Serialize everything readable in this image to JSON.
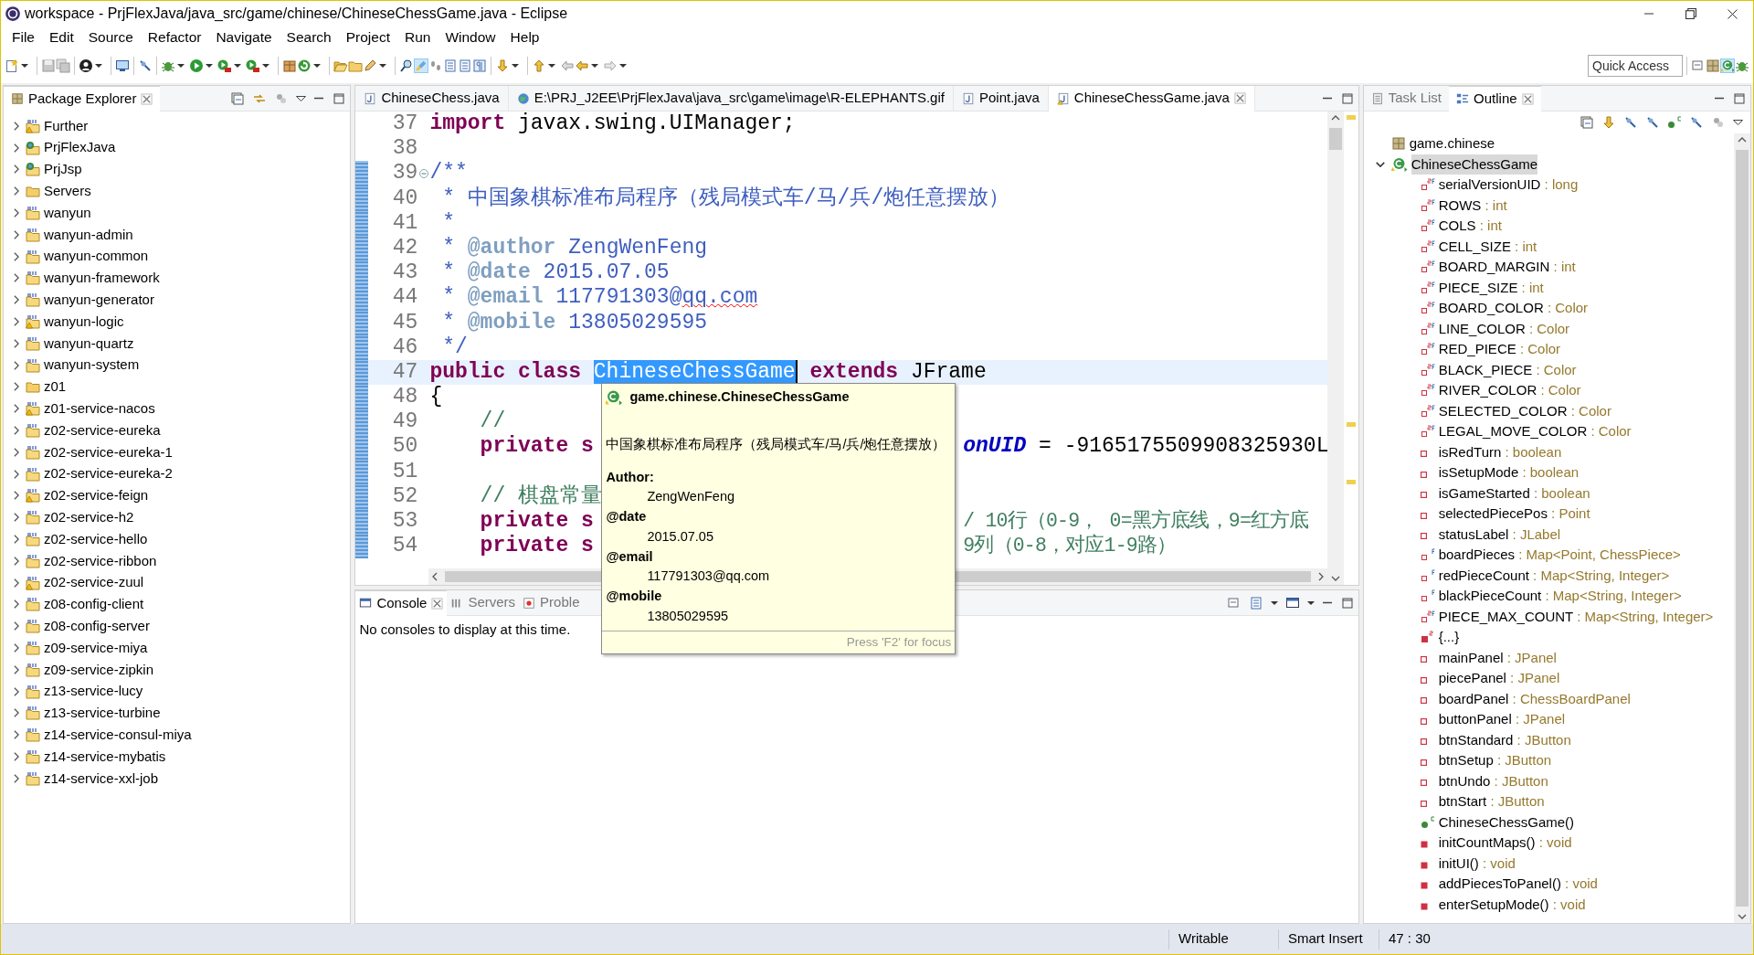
{
  "window": {
    "title": "workspace - PrjFlexJava/java_src/game/chinese/ChineseChessGame.java - Eclipse"
  },
  "menu": [
    "File",
    "Edit",
    "Source",
    "Refactor",
    "Navigate",
    "Search",
    "Project",
    "Run",
    "Window",
    "Help"
  ],
  "quick_access": {
    "placeholder": "Quick Access"
  },
  "package_explorer": {
    "title": "Package Explorer",
    "items": [
      {
        "label": "Further",
        "kind": "maven-warning",
        "expanded": false,
        "selected": false
      },
      {
        "label": "PrjFlexJava",
        "kind": "web",
        "expanded": false,
        "selected": false
      },
      {
        "label": "PrjJsp",
        "kind": "web",
        "expanded": false,
        "selected": false
      },
      {
        "label": "Servers",
        "kind": "folder",
        "expanded": false,
        "selected": false
      },
      {
        "label": "wanyun",
        "kind": "maven",
        "expanded": false,
        "selected": false
      },
      {
        "label": "wanyun-admin",
        "kind": "maven",
        "expanded": false,
        "selected": false
      },
      {
        "label": "wanyun-common",
        "kind": "maven",
        "expanded": false,
        "selected": false
      },
      {
        "label": "wanyun-framework",
        "kind": "maven",
        "expanded": false,
        "selected": false
      },
      {
        "label": "wanyun-generator",
        "kind": "maven",
        "expanded": false,
        "selected": false
      },
      {
        "label": "wanyun-logic",
        "kind": "maven-warning",
        "expanded": false,
        "selected": false
      },
      {
        "label": "wanyun-quartz",
        "kind": "maven",
        "expanded": false,
        "selected": false
      },
      {
        "label": "wanyun-system",
        "kind": "maven",
        "expanded": false,
        "selected": false
      },
      {
        "label": "z01",
        "kind": "folder",
        "expanded": false,
        "selected": false
      },
      {
        "label": "z01-service-nacos",
        "kind": "maven-warning",
        "expanded": false,
        "selected": false
      },
      {
        "label": "z02-service-eureka",
        "kind": "maven",
        "expanded": false,
        "selected": false
      },
      {
        "label": "z02-service-eureka-1",
        "kind": "maven",
        "expanded": false,
        "selected": false
      },
      {
        "label": "z02-service-eureka-2",
        "kind": "maven",
        "expanded": false,
        "selected": false
      },
      {
        "label": "z02-service-feign",
        "kind": "maven-warning",
        "expanded": false,
        "selected": false
      },
      {
        "label": "z02-service-h2",
        "kind": "maven",
        "expanded": false,
        "selected": false
      },
      {
        "label": "z02-service-hello",
        "kind": "maven",
        "expanded": false,
        "selected": false
      },
      {
        "label": "z02-service-ribbon",
        "kind": "maven",
        "expanded": false,
        "selected": false
      },
      {
        "label": "z02-service-zuul",
        "kind": "maven-warning",
        "expanded": false,
        "selected": false
      },
      {
        "label": "z08-config-client",
        "kind": "maven",
        "expanded": false,
        "selected": false
      },
      {
        "label": "z08-config-server",
        "kind": "maven",
        "expanded": false,
        "selected": false
      },
      {
        "label": "z09-service-miya",
        "kind": "maven",
        "expanded": false,
        "selected": false
      },
      {
        "label": "z09-service-zipkin",
        "kind": "maven",
        "expanded": false,
        "selected": false
      },
      {
        "label": "z13-service-lucy",
        "kind": "maven",
        "expanded": false,
        "selected": false
      },
      {
        "label": "z13-service-turbine",
        "kind": "maven",
        "expanded": false,
        "selected": false
      },
      {
        "label": "z14-service-consul-miya",
        "kind": "maven",
        "expanded": false,
        "selected": false
      },
      {
        "label": "z14-service-mybatis",
        "kind": "maven",
        "expanded": false,
        "selected": false
      },
      {
        "label": "z14-service-xxl-job",
        "kind": "maven",
        "expanded": false,
        "selected": false
      }
    ]
  },
  "editor": {
    "tabs": [
      {
        "label": "ChineseChess.java",
        "kind": "java",
        "selected": false
      },
      {
        "label": "E:\\PRJ_J2EE\\PrjFlexJava\\java_src\\game\\image\\R-ELEPHANTS.gif",
        "kind": "image",
        "selected": false
      },
      {
        "label": "Point.java",
        "kind": "java",
        "selected": false
      },
      {
        "label": "ChineseChessGame.java",
        "kind": "java-warning",
        "selected": true
      }
    ],
    "lines": [
      {
        "number": "37",
        "current": false,
        "changed": false,
        "foldable": false,
        "tokens": [
          {
            "text": "import",
            "kind": "keyword"
          },
          {
            "text": " javax.swing.UIManager;",
            "kind": "plain"
          }
        ]
      },
      {
        "number": "38",
        "current": false,
        "changed": false,
        "foldable": false
      },
      {
        "number": "39",
        "current": false,
        "changed": true,
        "foldable": true,
        "tokens": [
          {
            "text": "/**",
            "kind": "javadoc"
          }
        ]
      },
      {
        "number": "40",
        "current": false,
        "changed": true,
        "foldable": false,
        "tokens": [
          {
            "text": " * 中国象棋标准布局程序（残局模式车/马/兵/炮任意摆放）",
            "kind": "javadoc"
          }
        ]
      },
      {
        "number": "41",
        "current": false,
        "changed": true,
        "foldable": false,
        "tokens": [
          {
            "text": " *",
            "kind": "javadoc"
          }
        ]
      },
      {
        "number": "42",
        "current": false,
        "changed": true,
        "foldable": false,
        "tokens": [
          {
            "text": " * ",
            "kind": "javadoc"
          },
          {
            "text": "@author",
            "kind": "javadoc-tag"
          },
          {
            "text": " ZengWenFeng",
            "kind": "javadoc"
          }
        ]
      },
      {
        "number": "43",
        "current": false,
        "changed": true,
        "foldable": false,
        "tokens": [
          {
            "text": " * ",
            "kind": "javadoc"
          },
          {
            "text": "@date",
            "kind": "javadoc-tag"
          },
          {
            "text": " 2015.07.05",
            "kind": "javadoc"
          }
        ]
      },
      {
        "number": "44",
        "current": false,
        "changed": true,
        "foldable": false,
        "tokens": [
          {
            "text": " * ",
            "kind": "javadoc"
          },
          {
            "text": "@email",
            "kind": "javadoc-tag"
          },
          {
            "text": " 117791303@",
            "kind": "javadoc"
          },
          {
            "text": "qq.com",
            "kind": "misspelled"
          }
        ]
      },
      {
        "number": "45",
        "current": false,
        "changed": true,
        "foldable": false,
        "tokens": [
          {
            "text": " * ",
            "kind": "javadoc"
          },
          {
            "text": "@mobile",
            "kind": "javadoc-tag"
          },
          {
            "text": " 13805029595",
            "kind": "javadoc"
          }
        ]
      },
      {
        "number": "46",
        "current": false,
        "changed": true,
        "foldable": false,
        "tokens": [
          {
            "text": " */",
            "kind": "javadoc"
          }
        ]
      },
      {
        "number": "47",
        "current": true,
        "changed": true,
        "foldable": false,
        "tokens": [
          {
            "text": "public class ",
            "kind": "keyword"
          },
          {
            "text": "ChineseChessGame",
            "kind": "selection"
          },
          {
            "text": " extends",
            "kind": "keyword"
          },
          {
            "text": " JFrame",
            "kind": "plain"
          }
        ]
      },
      {
        "number": "48",
        "current": false,
        "changed": true,
        "foldable": false,
        "tokens": [
          {
            "text": "{",
            "kind": "plain"
          }
        ]
      },
      {
        "number": "49",
        "current": false,
        "changed": true,
        "foldable": false,
        "tokens": [
          {
            "text": "    //",
            "kind": "comment"
          }
        ]
      },
      {
        "number": "50",
        "current": false,
        "changed": true,
        "foldable": false,
        "tokens": [
          {
            "text": "    private s",
            "kind": "keyword"
          }
        ],
        "right": [
          {
            "text": "onUID",
            "kind": "static-field"
          },
          {
            "text": " = -9165175509908325930L",
            "kind": "plain"
          }
        ]
      },
      {
        "number": "51",
        "current": false,
        "changed": true,
        "foldable": false
      },
      {
        "number": "52",
        "current": false,
        "changed": true,
        "foldable": false,
        "tokens": [
          {
            "text": "    // 棋盘常量",
            "kind": "comment"
          }
        ]
      },
      {
        "number": "53",
        "current": false,
        "changed": true,
        "foldable": false,
        "tokens": [
          {
            "text": "    private s",
            "kind": "keyword"
          }
        ],
        "right": [
          {
            "text": "/ 10行（0-9， 0=黑方底线，9=红方底",
            "kind": "comment"
          }
        ]
      },
      {
        "number": "54",
        "current": false,
        "changed": true,
        "foldable": false,
        "tokens": [
          {
            "text": "    private s",
            "kind": "keyword"
          }
        ],
        "right": [
          {
            "text": "9列（0-8，对应1-9路）",
            "kind": "comment"
          }
        ]
      }
    ]
  },
  "tooltip": {
    "title": "game.chinese.ChineseChessGame",
    "description": "中国象棋标准布局程序（残局模式车/马/兵/炮任意摆放）",
    "tags": [
      {
        "label": "Author:",
        "value": "ZengWenFeng"
      },
      {
        "label": "@date",
        "value": "2015.07.05"
      },
      {
        "label": "@email",
        "value": "117791303@qq.com"
      },
      {
        "label": "@mobile",
        "value": "13805029595"
      }
    ],
    "footer": "Press 'F2' for focus"
  },
  "console": {
    "tabs": [
      {
        "label": "Console",
        "kind": "console",
        "selected": true
      },
      {
        "label": "Servers",
        "kind": "servers",
        "selected": false
      },
      {
        "label": "Proble",
        "kind": "problems",
        "selected": false
      }
    ],
    "message": "No consoles to display at this time."
  },
  "outline": {
    "tabs": [
      {
        "label": "Task List",
        "kind": "tasks",
        "selected": false
      },
      {
        "label": "Outline",
        "kind": "outline",
        "selected": true
      }
    ],
    "tree": [
      {
        "label": "game.chinese",
        "kind": "package",
        "selected": false
      },
      {
        "label": "ChineseChessGame",
        "kind": "class",
        "selected": true,
        "expanded": true,
        "children": [
          {
            "label": "serialVersionUID",
            "type": ": long",
            "kind": "static-final",
            "selected": false
          },
          {
            "label": "ROWS",
            "type": ": int",
            "kind": "static-final",
            "selected": false
          },
          {
            "label": "COLS",
            "type": ": int",
            "kind": "static-final",
            "selected": false
          },
          {
            "label": "CELL_SIZE",
            "type": ": int",
            "kind": "static-final",
            "selected": false
          },
          {
            "label": "BOARD_MARGIN",
            "type": ": int",
            "kind": "static-final",
            "selected": false
          },
          {
            "label": "PIECE_SIZE",
            "type": ": int",
            "kind": "static-final",
            "selected": false
          },
          {
            "label": "BOARD_COLOR",
            "type": ": Color",
            "kind": "static-final",
            "selected": false
          },
          {
            "label": "LINE_COLOR",
            "type": ": Color",
            "kind": "static-final",
            "selected": false
          },
          {
            "label": "RED_PIECE",
            "type": ": Color",
            "kind": "static-final",
            "selected": false
          },
          {
            "label": "BLACK_PIECE",
            "type": ": Color",
            "kind": "static-final",
            "selected": false
          },
          {
            "label": "RIVER_COLOR",
            "type": ": Color",
            "kind": "static-final",
            "selected": false
          },
          {
            "label": "SELECTED_COLOR",
            "type": ": Color",
            "kind": "static-final",
            "selected": false
          },
          {
            "label": "LEGAL_MOVE_COLOR",
            "type": ": Color",
            "kind": "static-final",
            "selected": false
          },
          {
            "label": "isRedTurn",
            "type": ": boolean",
            "kind": "field",
            "selected": false
          },
          {
            "label": "isSetupMode",
            "type": ": boolean",
            "kind": "field",
            "selected": false
          },
          {
            "label": "isGameStarted",
            "type": ": boolean",
            "kind": "field",
            "selected": false
          },
          {
            "label": "selectedPiecePos",
            "type": ": Point",
            "kind": "field",
            "selected": false
          },
          {
            "label": "statusLabel",
            "type": ": JLabel",
            "kind": "field",
            "selected": false
          },
          {
            "label": "boardPieces",
            "type": ": Map<Point, ChessPiece>",
            "kind": "final-field",
            "selected": false
          },
          {
            "label": "redPieceCount",
            "type": ": Map<String, Integer>",
            "kind": "final-field",
            "selected": false
          },
          {
            "label": "blackPieceCount",
            "type": ": Map<String, Integer>",
            "kind": "final-field",
            "selected": false
          },
          {
            "label": "PIECE_MAX_COUNT",
            "type": ": Map<String, Integer>",
            "kind": "static-final",
            "selected": false
          },
          {
            "label": "{...}",
            "kind": "static-init",
            "selected": false
          },
          {
            "label": "mainPanel",
            "type": ": JPanel",
            "kind": "field",
            "selected": false
          },
          {
            "label": "piecePanel",
            "type": ": JPanel",
            "kind": "field",
            "selected": false
          },
          {
            "label": "boardPanel",
            "type": ": ChessBoardPanel",
            "kind": "field",
            "selected": false
          },
          {
            "label": "buttonPanel",
            "type": ": JPanel",
            "kind": "field",
            "selected": false
          },
          {
            "label": "btnStandard",
            "type": ": JButton",
            "kind": "field",
            "selected": false
          },
          {
            "label": "btnSetup",
            "type": ": JButton",
            "kind": "field",
            "selected": false
          },
          {
            "label": "btnUndo",
            "type": ": JButton",
            "kind": "field",
            "selected": false
          },
          {
            "label": "btnStart",
            "type": ": JButton",
            "kind": "field",
            "selected": false
          },
          {
            "label": "ChineseChessGame()",
            "kind": "constructor",
            "selected": false
          },
          {
            "label": "initCountMaps()",
            "type": ": void",
            "kind": "method",
            "selected": false
          },
          {
            "label": "initUI()",
            "type": ": void",
            "kind": "method",
            "selected": false
          },
          {
            "label": "addPiecesToPanel()",
            "type": ": void",
            "kind": "method",
            "selected": false
          },
          {
            "label": "enterSetupMode()",
            "type": ": void",
            "kind": "method",
            "selected": false
          }
        ]
      }
    ]
  },
  "status_bar": [
    "Writable",
    "Smart Insert",
    "47 : 30"
  ]
}
